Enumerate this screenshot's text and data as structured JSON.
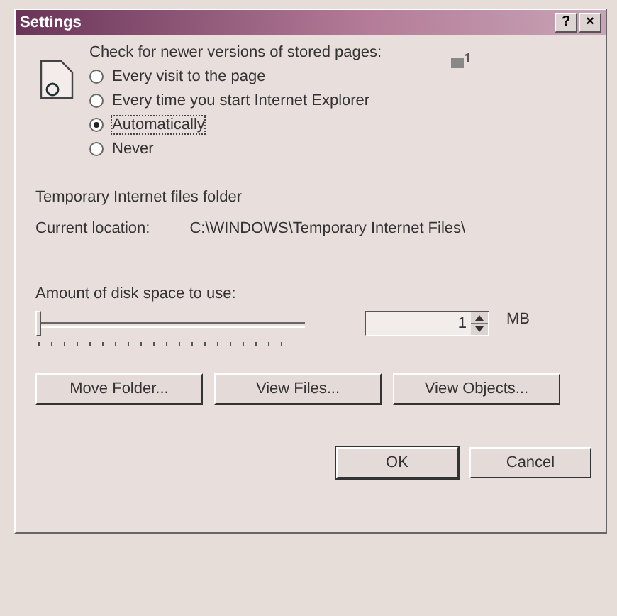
{
  "window": {
    "title": "Settings",
    "help": "?",
    "close": "×"
  },
  "check": {
    "label": "Check for newer versions of stored pages:",
    "options": [
      {
        "label": "Every visit to the page",
        "selected": false
      },
      {
        "label": "Every time you start Internet Explorer",
        "selected": false
      },
      {
        "label": "Automatically",
        "selected": true
      },
      {
        "label": "Never",
        "selected": false
      }
    ]
  },
  "folder": {
    "heading": "Temporary Internet files folder",
    "location_label": "Current location:",
    "location": "C:\\WINDOWS\\Temporary Internet Files\\"
  },
  "disk": {
    "label": "Amount of disk space to use:",
    "level": 0.0,
    "value": "1",
    "unit": "MB"
  },
  "folder_buttons": [
    "Move Folder...",
    "View Files...",
    "View Objects..."
  ],
  "buttons": [
    "OK",
    "Cancel"
  ]
}
